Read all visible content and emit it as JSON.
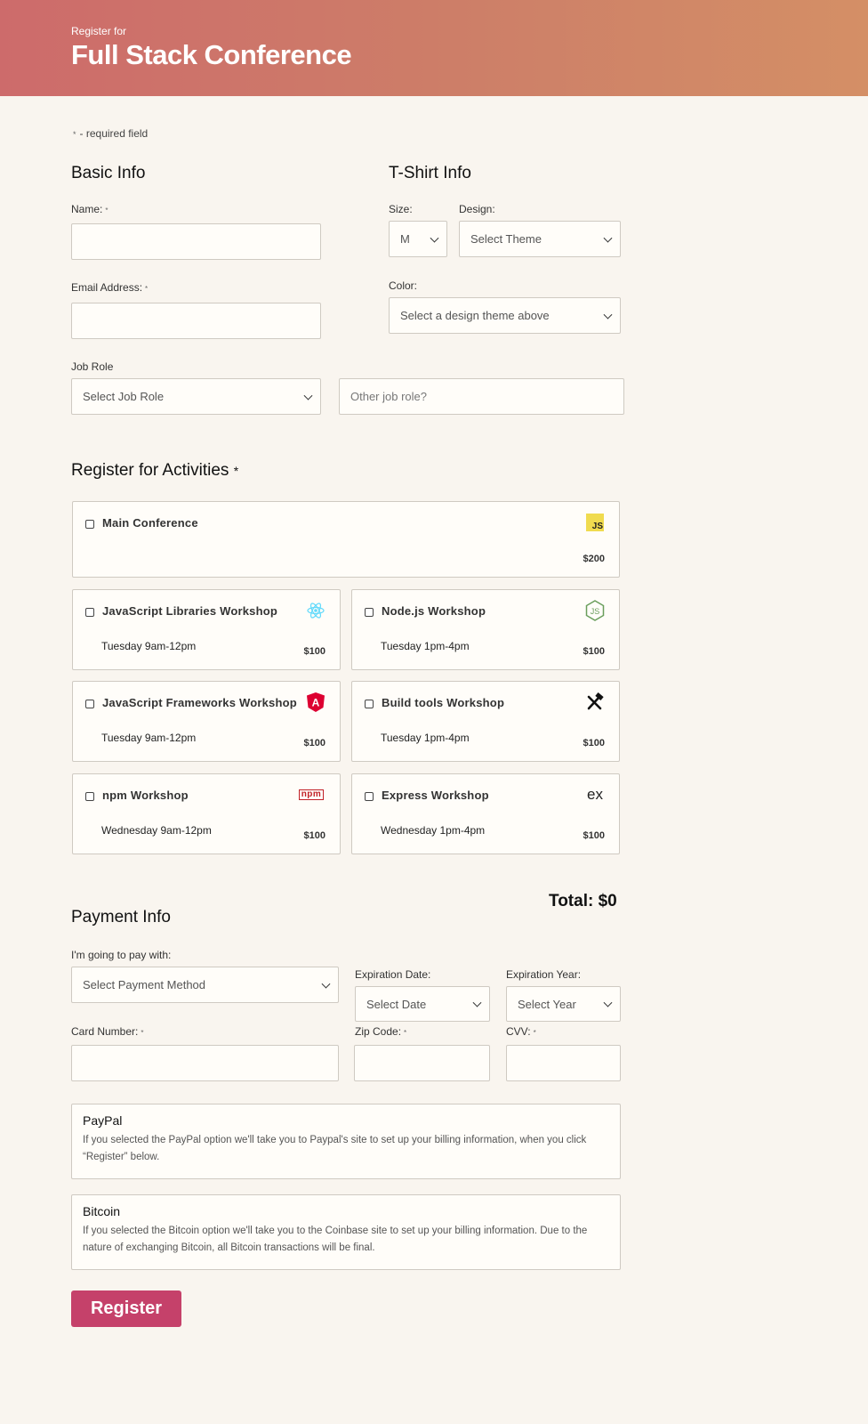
{
  "header": {
    "pre": "Register for",
    "title": "Full Stack Conference"
  },
  "required_note": {
    "star": "*",
    "text": "- required field"
  },
  "basic_info": {
    "heading": "Basic Info",
    "name_label": "Name:",
    "email_label": "Email Address:",
    "job_role_label": "Job Role",
    "job_role_value": "Select Job Role",
    "other_job_placeholder": "Other job role?",
    "required_star": "*"
  },
  "tshirt": {
    "heading": "T-Shirt Info",
    "size_label": "Size:",
    "size_value": "M",
    "design_label": "Design:",
    "design_value": "Select Theme",
    "color_label": "Color:",
    "color_value": "Select a design theme above"
  },
  "activities": {
    "heading": "Register for Activities",
    "required_star": "*",
    "items": [
      {
        "name": "Main Conference",
        "time": "",
        "price": "$200",
        "icon": "javascript-icon",
        "icon_text": "JS"
      },
      {
        "name": "JavaScript Libraries Workshop",
        "time": "Tuesday 9am-12pm",
        "price": "$100",
        "icon": "react-icon"
      },
      {
        "name": "Node.js Workshop",
        "time": "Tuesday 1pm-4pm",
        "price": "$100",
        "icon": "nodejs-icon",
        "icon_text": "JS"
      },
      {
        "name": "JavaScript Frameworks Workshop",
        "time": "Tuesday 9am-12pm",
        "price": "$100",
        "icon": "angular-icon",
        "icon_text": "A"
      },
      {
        "name": "Build tools Workshop",
        "time": "Tuesday 1pm-4pm",
        "price": "$100",
        "icon": "build-tools-icon"
      },
      {
        "name": "npm Workshop",
        "time": "Wednesday 9am-12pm",
        "price": "$100",
        "icon": "npm-icon",
        "icon_text": "npm"
      },
      {
        "name": "Express Workshop",
        "time": "Wednesday 1pm-4pm",
        "price": "$100",
        "icon": "express-icon",
        "icon_text": "ex"
      }
    ],
    "total": "Total: $0"
  },
  "payment": {
    "heading": "Payment Info",
    "pay_with_label": "I'm going to pay with:",
    "pay_with_value": "Select Payment Method",
    "exp_date_label": "Expiration Date:",
    "exp_date_value": "Select Date",
    "exp_year_label": "Expiration Year:",
    "exp_year_value": "Select Year",
    "card_label": "Card Number:",
    "zip_label": "Zip Code:",
    "cvv_label": "CVV:",
    "required_star": "*"
  },
  "paypal": {
    "heading": "PayPal",
    "text": "If you selected the PayPal option we'll take you to Paypal's site to set up your billing information, when you click “Register” below."
  },
  "bitcoin": {
    "heading": "Bitcoin",
    "text": "If you selected the Bitcoin option we'll take you to the Coinbase site to set up your billing information. Due to the nature of exchanging Bitcoin, all Bitcoin transactions will be final."
  },
  "register_button": "Register",
  "colors": {
    "header_start": "#cd6b6b",
    "header_end": "#d48f66",
    "button": "#c5416a",
    "background": "#f9f5ef"
  }
}
